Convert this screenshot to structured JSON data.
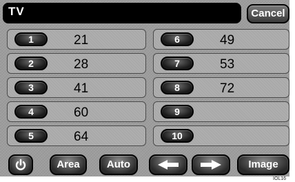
{
  "header": {
    "title": "TV",
    "cancel_label": "Cancel"
  },
  "presets": {
    "left": [
      {
        "num": "1",
        "value": "21"
      },
      {
        "num": "2",
        "value": "28"
      },
      {
        "num": "3",
        "value": "41"
      },
      {
        "num": "4",
        "value": "60"
      },
      {
        "num": "5",
        "value": "64"
      }
    ],
    "right": [
      {
        "num": "6",
        "value": "49"
      },
      {
        "num": "7",
        "value": "53"
      },
      {
        "num": "8",
        "value": "72"
      },
      {
        "num": "9",
        "value": ""
      },
      {
        "num": "10",
        "value": ""
      }
    ]
  },
  "toolbar": {
    "power_icon": "power-icon",
    "area_label": "Area",
    "auto_label": "Auto",
    "prev_icon": "arrow-left-icon",
    "next_icon": "arrow-right-icon",
    "image_label": "Image"
  },
  "footer": {
    "reference": "IOL16"
  }
}
